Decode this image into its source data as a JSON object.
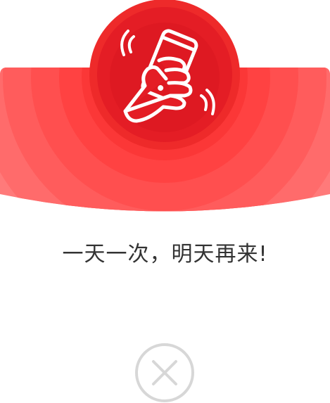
{
  "modal": {
    "message": "一天一次，明天再来!",
    "icon": "shake-phone-icon",
    "close_icon": "close-icon"
  },
  "colors": {
    "banner_outer": "#ff7474",
    "banner_inner": "#f43a3a",
    "circle": "#e41d25",
    "close_gray": "#d7d7d7",
    "text": "#333333"
  }
}
